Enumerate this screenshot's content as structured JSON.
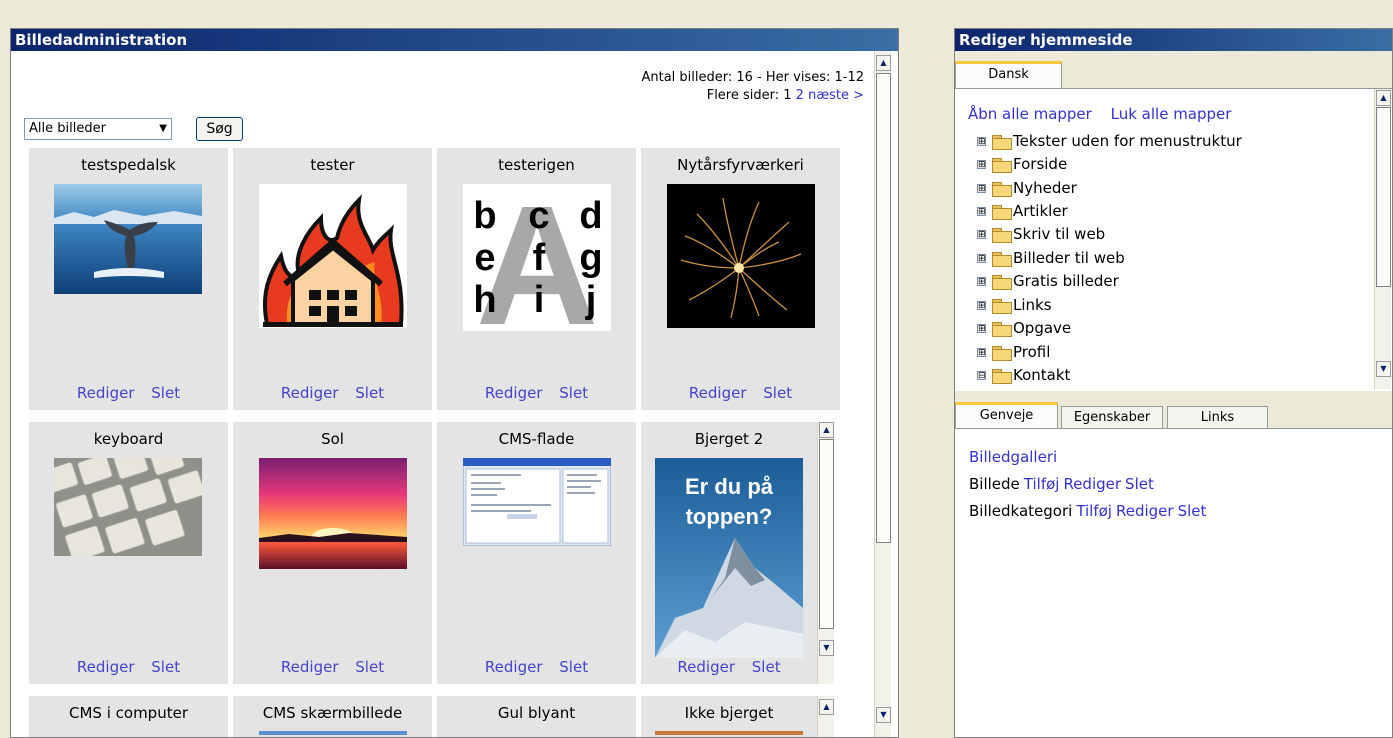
{
  "image_admin": {
    "title": "Billedadministration",
    "count_text": "Antal billeder: 16 - Her vises: 1-12",
    "more_pages_label": "Flere sider: 1",
    "page2_link": "2",
    "next_link": "næste >",
    "filter_value": "Alle billeder",
    "search_button": "Søg",
    "edit_label": "Rediger",
    "delete_label": "Slet",
    "rows": [
      [
        {
          "title": "testspedalsk",
          "image": "whale-tail-photo"
        },
        {
          "title": "tester",
          "image": "burning-house-icon"
        },
        {
          "title": "testerigen",
          "image": "alphabet-letters-image",
          "letters": [
            "b",
            "c",
            "d",
            "e",
            "f",
            "g",
            "h",
            "i",
            "j"
          ],
          "big_letter": "A"
        },
        {
          "title": "Nytårsfyrværkeri",
          "image": "fireworks-photo"
        }
      ],
      [
        {
          "title": "keyboard",
          "image": "keyboard-photo"
        },
        {
          "title": "Sol",
          "image": "sunset-photo"
        },
        {
          "title": "CMS-flade",
          "image": "cms-screenshot"
        },
        {
          "title": "Bjerget 2",
          "image": "mountain-poster",
          "poster_text_1": "Er du på",
          "poster_text_2": "toppen?"
        }
      ],
      [
        {
          "title": "CMS i computer"
        },
        {
          "title": "CMS skærmbillede"
        },
        {
          "title": "Gul blyant"
        },
        {
          "title": "Ikke bjerget"
        }
      ]
    ]
  },
  "edit_site": {
    "title": "Rediger hjemmeside",
    "lang_tab": "Dansk",
    "open_all": "Åbn alle mapper",
    "close_all": "Luk alle mapper",
    "tree": [
      {
        "label": "Tekster uden for menustruktur",
        "state": "⊞"
      },
      {
        "label": "Forside",
        "state": "⊞"
      },
      {
        "label": "Nyheder",
        "state": "⊞"
      },
      {
        "label": "Artikler",
        "state": "⊞"
      },
      {
        "label": "Skriv til web",
        "state": "⊞"
      },
      {
        "label": "Billeder til web",
        "state": "⊞"
      },
      {
        "label": "Gratis billeder",
        "state": "⊞"
      },
      {
        "label": "Links",
        "state": "⊞"
      },
      {
        "label": "Opgave",
        "state": "⊞"
      },
      {
        "label": "Profil",
        "state": "⊞"
      },
      {
        "label": "Kontakt",
        "state": "⊟"
      }
    ],
    "tabs": [
      "Genveje",
      "Egenskaber",
      "Links"
    ],
    "shortcut_gallery": "Billedgalleri",
    "image_label": "Billede",
    "category_label": "Billedkategori",
    "add_label": "Tilføj",
    "edit_label": "Rediger",
    "delete_label": "Slet"
  }
}
